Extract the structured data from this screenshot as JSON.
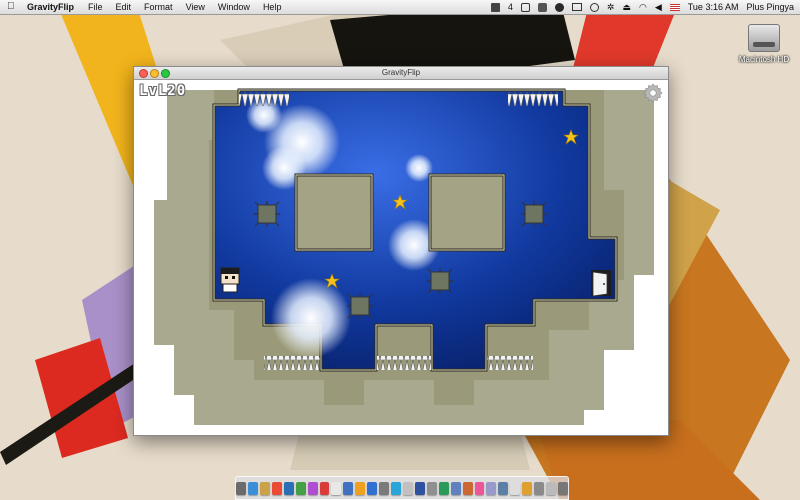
{
  "menubar": {
    "app_name": "GravityFlip",
    "menus": [
      "File",
      "Edit",
      "Format",
      "View",
      "Window",
      "Help"
    ],
    "clock": "Tue 3:16 AM",
    "user": "Plus Pingya",
    "badge": "4"
  },
  "desktop": {
    "disk_label": "Macintosh HD"
  },
  "window": {
    "title": "GravityFlip"
  },
  "game": {
    "level_label": "LvL20",
    "stars_count": 3,
    "spiked_blocks_count": 4
  },
  "colors": {
    "sky_blue": "#0d2f8c",
    "wall_khaki": "#9a9a7a",
    "block_fill": "#a4a386",
    "star": "#f5c21b",
    "wallpaper": "#e7dccb"
  },
  "dock": {
    "items": [
      "#6b6b6b",
      "#3a8fd6",
      "#caa24a",
      "#e94b35",
      "#2d6fb4",
      "#45a045",
      "#b04dd0",
      "#d93a3a",
      "#e8e8e8",
      "#4070c0",
      "#f0a020",
      "#3070d0",
      "#7a7a7a",
      "#2aa5d8",
      "#c0c0c0",
      "#3050a0",
      "#909090",
      "#2a9a5a",
      "#6080c0",
      "#cc6633",
      "#ee5599",
      "#9999cc",
      "#5c7fa8",
      "#dddddd",
      "#e0a030",
      "#8a8a8a",
      "#bbbbbb",
      "#777777"
    ]
  }
}
